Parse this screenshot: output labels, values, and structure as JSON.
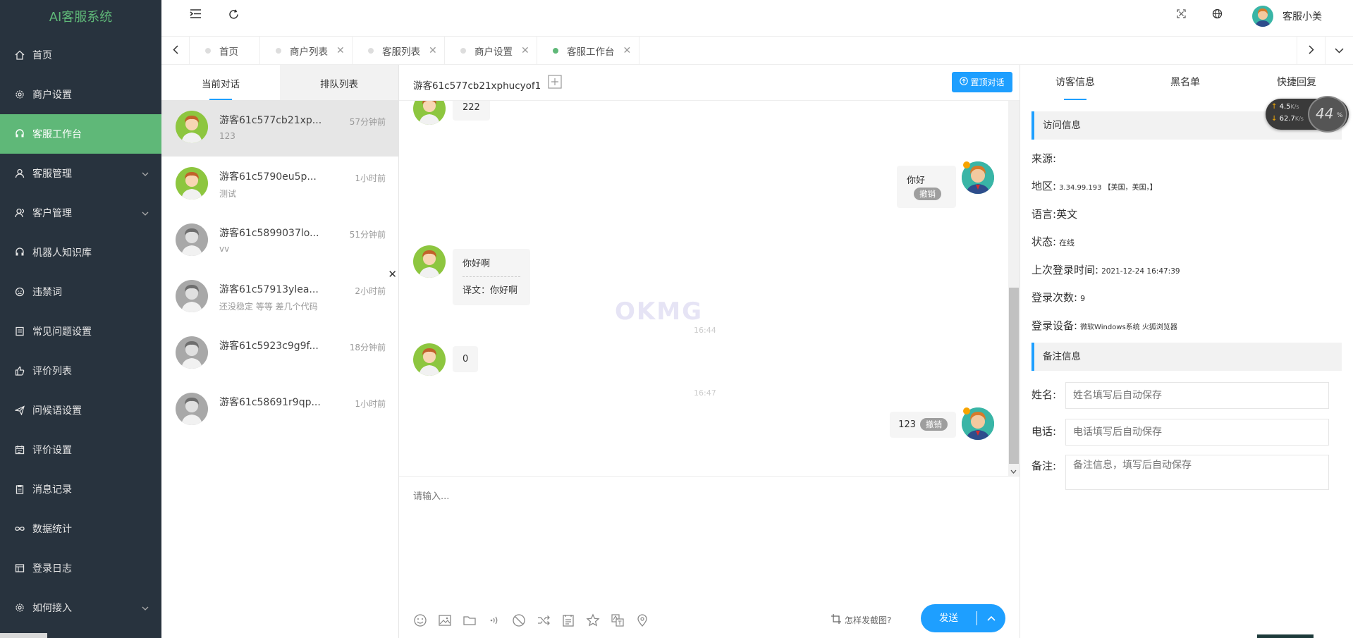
{
  "sidebar": {
    "brand": "AI客服系统",
    "items": [
      {
        "label": "首页"
      },
      {
        "label": "商户设置"
      },
      {
        "label": "客服工作台"
      },
      {
        "label": "客服管理"
      },
      {
        "label": "客户管理"
      },
      {
        "label": "机器人知识库"
      },
      {
        "label": "违禁词"
      },
      {
        "label": "常见问题设置"
      },
      {
        "label": "评价列表"
      },
      {
        "label": "问候语设置"
      },
      {
        "label": "评价设置"
      },
      {
        "label": "消息记录"
      },
      {
        "label": "数据统计"
      },
      {
        "label": "登录日志"
      },
      {
        "label": "如何接入"
      }
    ]
  },
  "header": {
    "user_name": "客服小美"
  },
  "tabs": [
    {
      "label": "首页"
    },
    {
      "label": "商户列表"
    },
    {
      "label": "客服列表"
    },
    {
      "label": "商户设置"
    },
    {
      "label": "客服工作台"
    }
  ],
  "conversation_panel": {
    "tabs": [
      "当前对话",
      "排队列表"
    ],
    "items": [
      {
        "name": "游客61c577cb21xp...",
        "message": "123",
        "time": "57分钟前"
      },
      {
        "name": "游客61c5790eu5p...",
        "message": "测试",
        "time": "1小时前"
      },
      {
        "name": "游客61c5899037lo...",
        "message": "vv",
        "time": "51分钟前"
      },
      {
        "name": "游客61c57913ylea...",
        "message": "还没稳定 等等 差几个代码",
        "time": "2小时前"
      },
      {
        "name": "游客61c5923c9g9f...",
        "message": "",
        "time": "18分钟前"
      },
      {
        "name": "游客61c58691r9qp...",
        "message": "",
        "time": "1小时前"
      }
    ]
  },
  "chat": {
    "visitor_id": "游客61c577cb21xphucyof1",
    "top_button": "置顶对话",
    "messages": {
      "m1": "222",
      "m2": "你好",
      "revoke": "撤销",
      "m3": "你好啊",
      "m3_translation": "译文：你好啊",
      "time1": "16:44",
      "m4": "0",
      "time2": "16:47",
      "m5": "123"
    },
    "input_placeholder": "请输入...",
    "screenshot_tip": "怎样发截图?",
    "send_label": "发送",
    "watermark": "OKMG"
  },
  "info_panel": {
    "tabs": [
      "访客信息",
      "黑名单",
      "快捷回复"
    ],
    "visit_section": "访问信息",
    "source_label": "来源:",
    "source_value": "",
    "region_label": "地区:",
    "region_value": "3.34.99.193 【美国，美国，】",
    "language_label": "语言:",
    "language_value": "英文",
    "status_label": "状态:",
    "status_value": "在线",
    "last_login_label": "上次登录时间:",
    "last_login_value": "2021-12-24 16:47:39",
    "login_count_label": "登录次数:",
    "login_count_value": "9",
    "device_label": "登录设备:",
    "device_value": "微软Windows系统 火狐浏览器",
    "remark_section": "备注信息",
    "name_label": "姓名:",
    "name_placeholder": "姓名填写后自动保存",
    "phone_label": "电话:",
    "phone_placeholder": "电话填写后自动保存",
    "note_label": "备注:",
    "note_placeholder": "备注信息，填写后自动保存"
  },
  "speed_widget": {
    "up": "4.5",
    "down": "62.7",
    "unit": "K/s",
    "percent": "44",
    "percent_sign": "%"
  }
}
